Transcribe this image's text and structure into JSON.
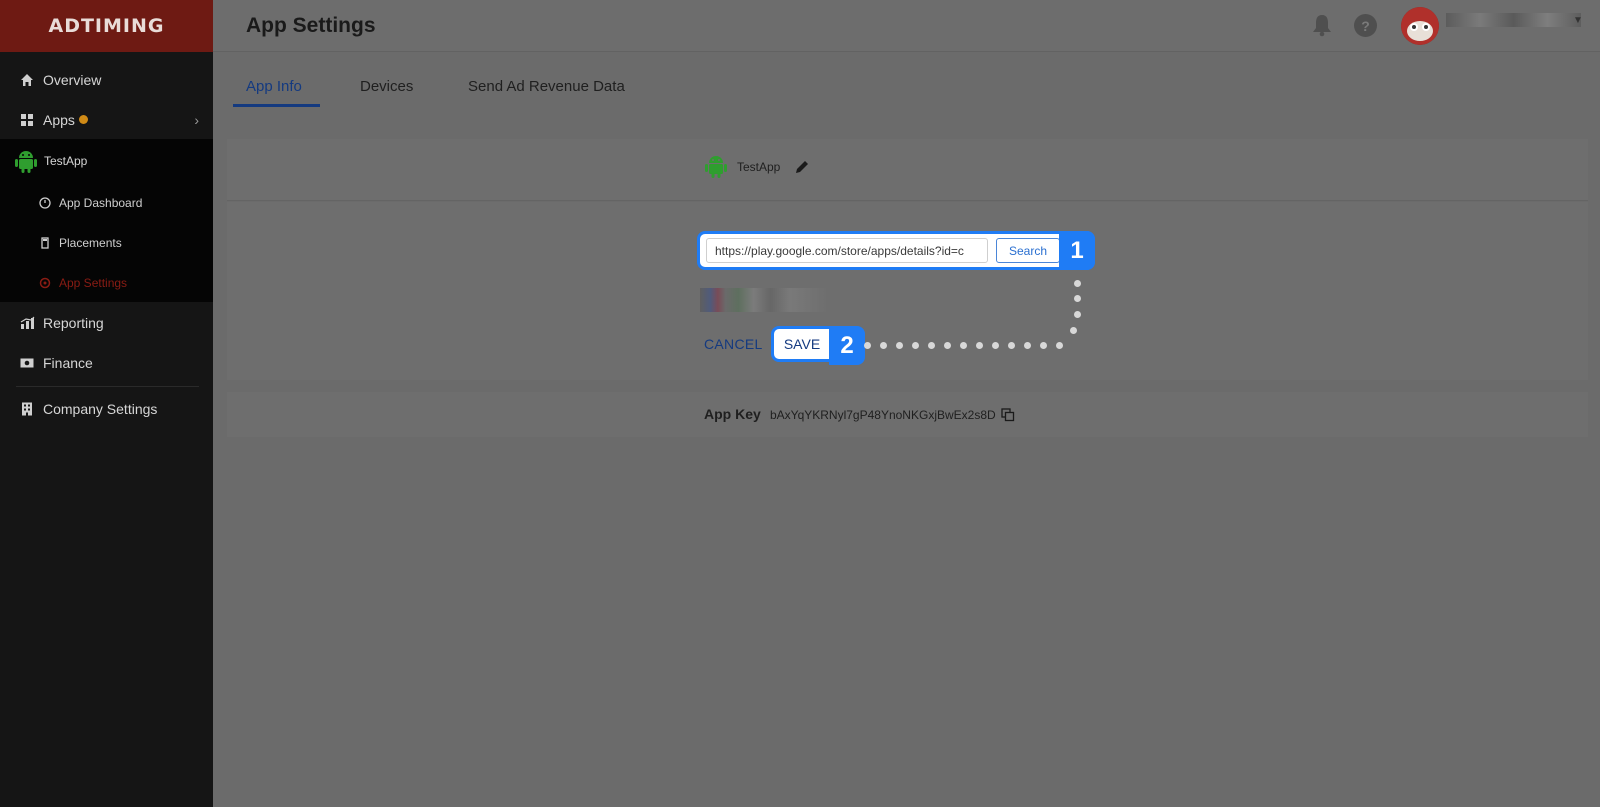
{
  "brand": {
    "logo_text": "ADTIMING"
  },
  "sidebar": {
    "items": [
      {
        "label": "Overview",
        "icon": "home-icon"
      },
      {
        "label": "Apps",
        "icon": "apps-grid-icon"
      },
      {
        "label": "TestApp",
        "icon": "android-icon"
      },
      {
        "label": "Reporting",
        "icon": "chart-icon"
      },
      {
        "label": "Finance",
        "icon": "money-icon"
      },
      {
        "label": "Company Settings",
        "icon": "building-icon"
      }
    ],
    "subitems": [
      {
        "label": "App Dashboard",
        "icon": "dashboard-icon"
      },
      {
        "label": "Placements",
        "icon": "placement-icon"
      },
      {
        "label": "App Settings",
        "icon": "settings-icon",
        "active": true
      }
    ]
  },
  "header": {
    "title": "App Settings"
  },
  "tabs": [
    {
      "label": "App Info",
      "active": true
    },
    {
      "label": "Devices"
    },
    {
      "label": "Send Ad Revenue Data"
    }
  ],
  "app": {
    "name": "TestApp"
  },
  "store_search": {
    "url_value": "https://play.google.com/store/apps/details?id=c",
    "search_label": "Search"
  },
  "actions": {
    "cancel_label": "CANCEL",
    "save_label": "SAVE"
  },
  "app_key": {
    "label": "App Key",
    "value": "bAxYqYKRNyl7gP48YnoNKGxjBwEx2s8D"
  },
  "annotations": {
    "step1": "1",
    "step2": "2"
  },
  "colors": {
    "accent": "#1f7cf5",
    "sidebar_active": "#8a1c14",
    "brand_bar": "#6e1a13",
    "link": "#143a80",
    "android": "#2f9e2f"
  }
}
